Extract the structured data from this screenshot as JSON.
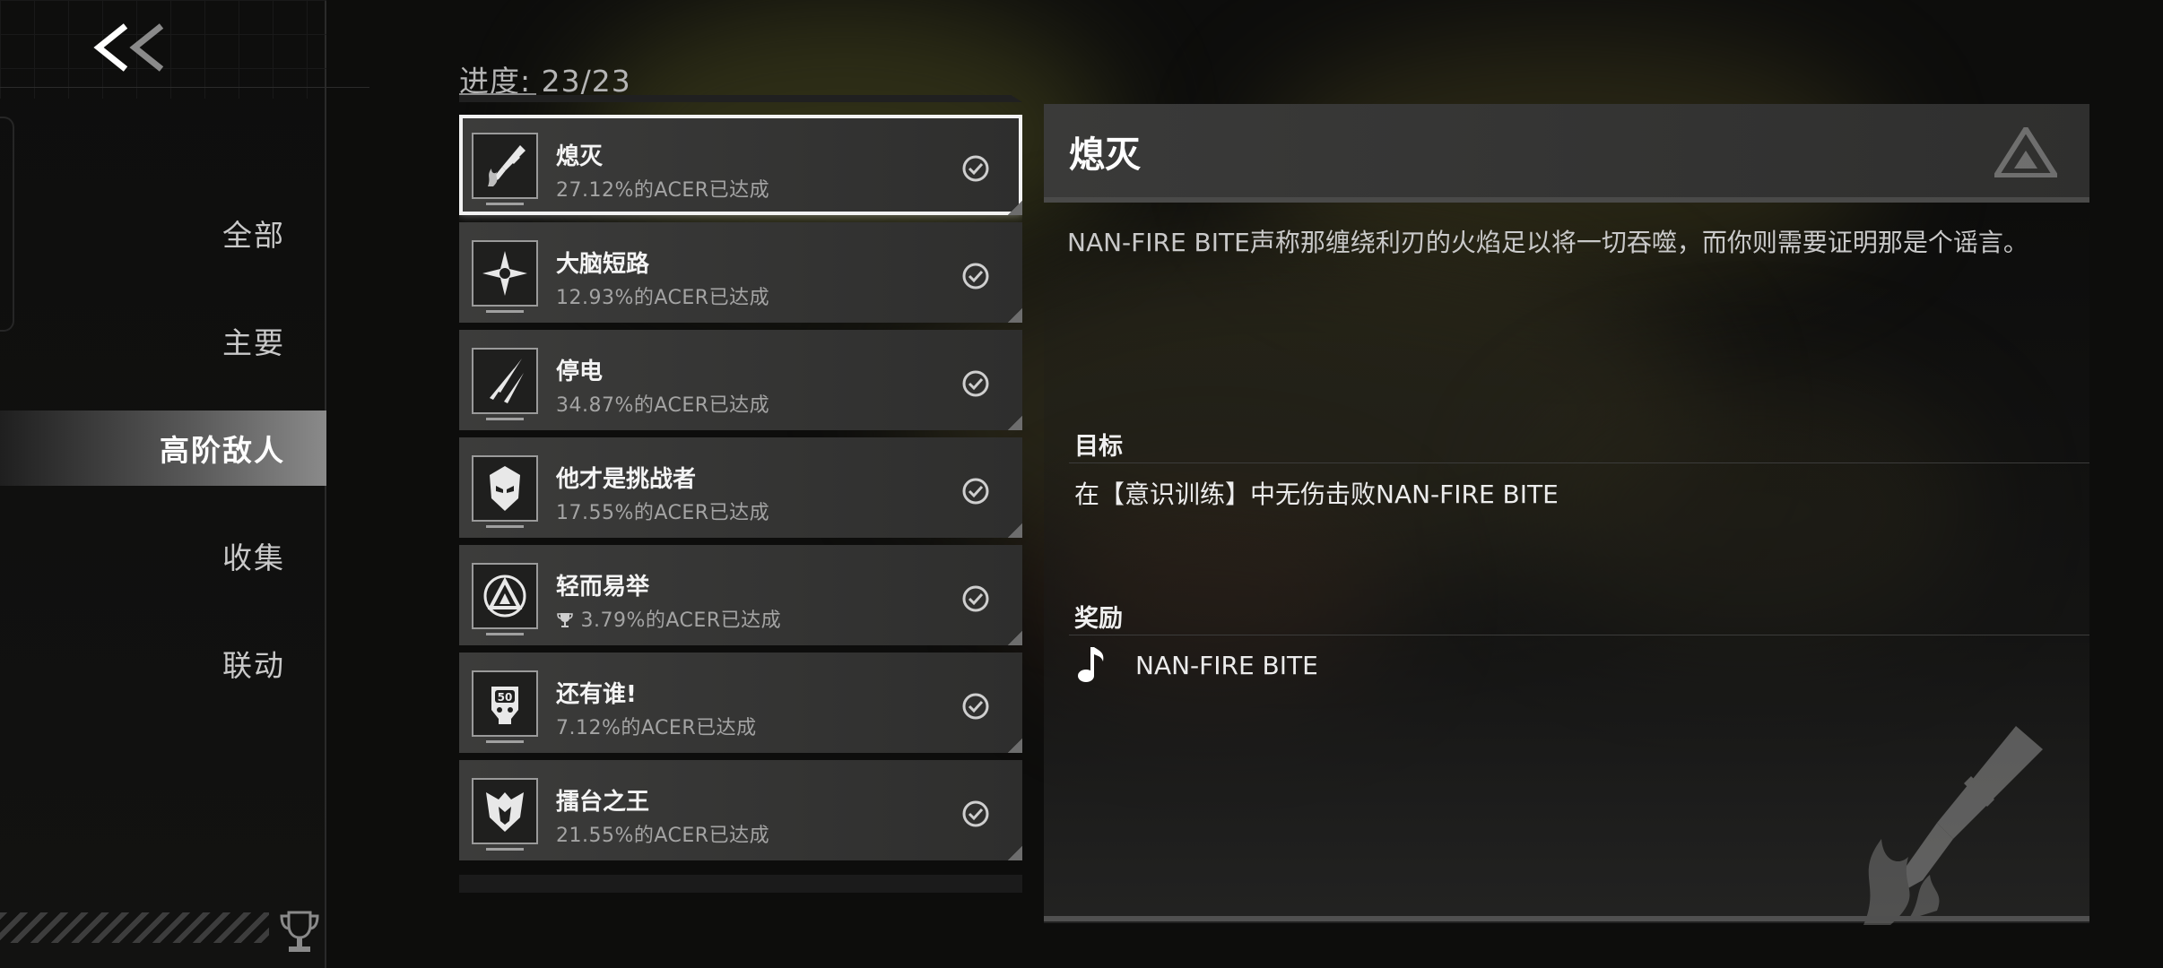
{
  "nav": {
    "back_label": "<<",
    "categories": [
      {
        "label": "全部",
        "active": false
      },
      {
        "label": "主要",
        "active": false
      },
      {
        "label": "高阶敌人",
        "active": true
      },
      {
        "label": "收集",
        "active": false
      },
      {
        "label": "联动",
        "active": false
      }
    ]
  },
  "progress": {
    "label": "进度:",
    "value": "23/23"
  },
  "achievements": [
    {
      "title": "熄灭",
      "rate": "27.12%的ACER已达成",
      "completed": true,
      "selected": true,
      "icon": "blade-icon"
    },
    {
      "title": "大脑短路",
      "rate": "12.93%的ACER已达成",
      "completed": true,
      "selected": false,
      "icon": "star-icon"
    },
    {
      "title": "停电",
      "rate": "34.87%的ACER已达成",
      "completed": true,
      "selected": false,
      "icon": "claw-icon"
    },
    {
      "title": "他才是挑战者",
      "rate": "17.55%的ACER已达成",
      "completed": true,
      "selected": false,
      "icon": "helmet-icon"
    },
    {
      "title": "轻而易举",
      "rate": "3.79%的ACER已达成",
      "completed": true,
      "selected": false,
      "icon": "triangle-logo-icon",
      "trophy": true
    },
    {
      "title": "还有谁!",
      "rate": "7.12%的ACER已达成",
      "completed": true,
      "selected": false,
      "icon": "skull-50-icon"
    },
    {
      "title": "擂台之王",
      "rate": "21.55%的ACER已达成",
      "completed": true,
      "selected": false,
      "icon": "crest-icon"
    }
  ],
  "detail": {
    "title": "熄灭",
    "description": "NAN-FIRE BITE声称那缠绕利刃的火焰足以将一切吞噬，而你则需要证明那是个谣言。",
    "goal_label": "目标",
    "goal_text": "在【意识训练】中无伤击败NAN-FIRE BITE",
    "reward_label": "奖励",
    "reward_icon": "music-note-icon",
    "reward_text": "NAN-FIRE BITE"
  },
  "colors": {
    "background": "#0d0d0c",
    "card": "#363635",
    "accent_active": "#8a8a8a",
    "text_primary": "#f4f4f4",
    "text_secondary": "#a4a4a4"
  }
}
